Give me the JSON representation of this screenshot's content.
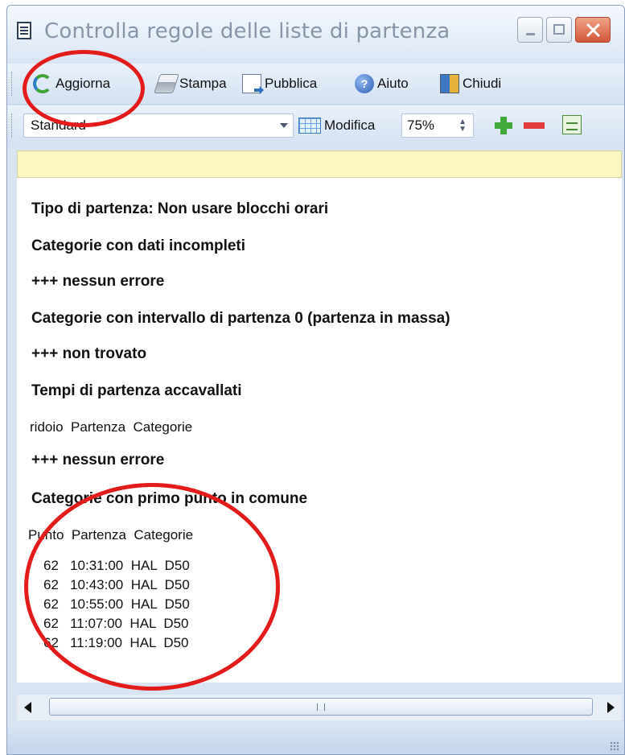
{
  "window": {
    "title": "Controlla regole delle liste di partenza"
  },
  "toolbar": {
    "refresh": "Aggiorna",
    "print": "Stampa",
    "publish": "Pubblica",
    "help": "Aiuto",
    "close": "Chiudi"
  },
  "view": {
    "selected_layout": "Standard",
    "edit": "Modifica",
    "zoom": "75%"
  },
  "report": {
    "start_type": "Tipo di partenza: Non usare blocchi orari",
    "incomplete_heading": "Categorie con dati incompleti",
    "incomplete_result": "+++ nessun errore",
    "zero_interval_heading": "Categorie con intervallo di partenza 0 (partenza in massa)",
    "zero_interval_result": "+++ non trovato",
    "overlap_heading": "Tempi di partenza accavallati",
    "overlap_columns": "ridoio  Partenza  Categorie",
    "overlap_result": "+++ nessun errore",
    "first_control_heading": "Categorie con primo punto in comune",
    "first_control_columns": "Punto  Partenza  Categorie",
    "rows": [
      "62   10:31:00  HAL  D50",
      "62   10:43:00  HAL  D50",
      "62   10:55:00  HAL  D50",
      "62   11:07:00  HAL  D50",
      "62   11:19:00  HAL  D50"
    ]
  },
  "colors": {
    "annotation": "#e31b1b",
    "notice_bar": "#fbf7c0"
  }
}
